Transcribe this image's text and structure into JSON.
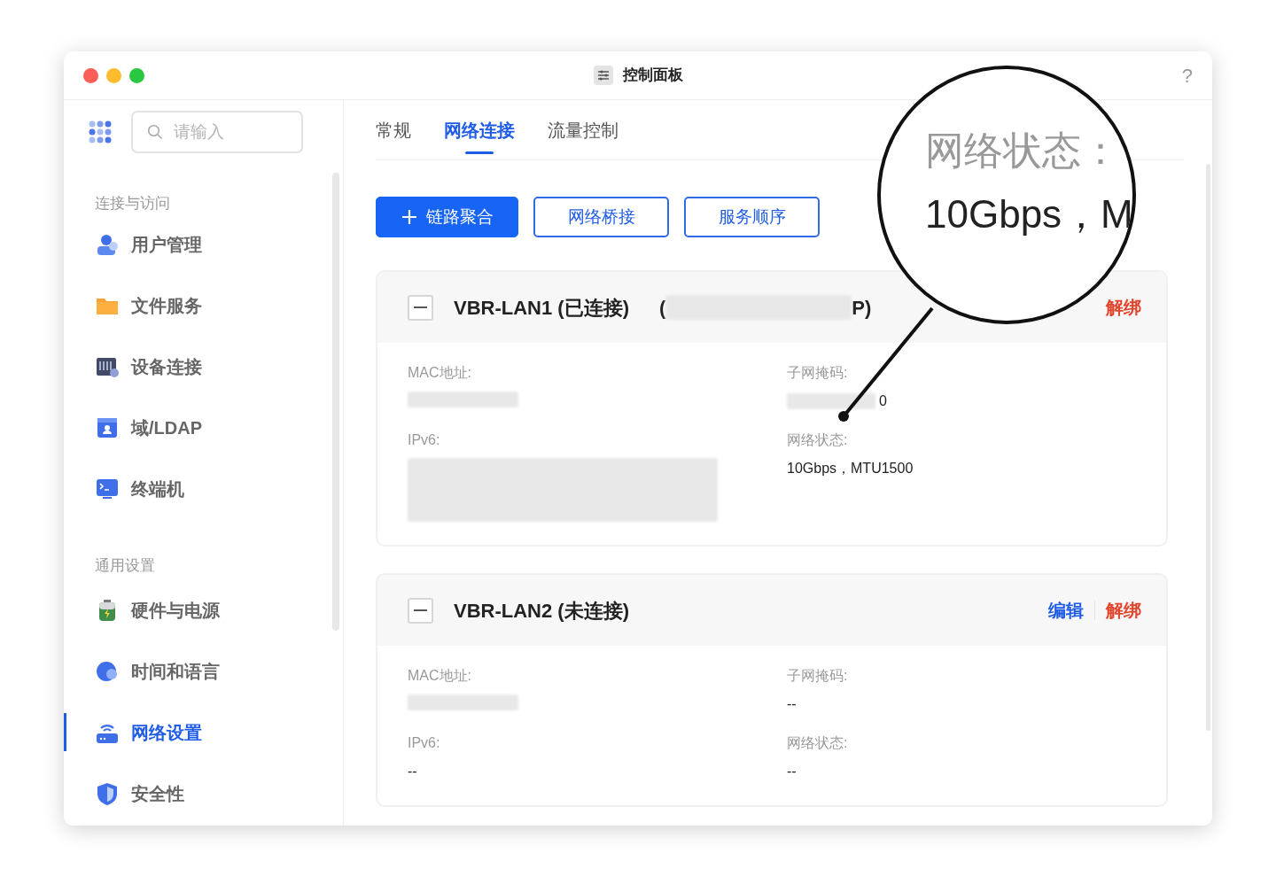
{
  "window": {
    "title": "控制面板",
    "help": "?"
  },
  "sidebar": {
    "search": {
      "placeholder": "请输入"
    },
    "sections": [
      {
        "heading": "连接与访问",
        "items": [
          {
            "label": "用户管理",
            "selected": false
          },
          {
            "label": "文件服务",
            "selected": false
          },
          {
            "label": "设备连接",
            "selected": false
          },
          {
            "label": "域/LDAP",
            "selected": false
          },
          {
            "label": "终端机",
            "selected": false
          }
        ]
      },
      {
        "heading": "通用设置",
        "items": [
          {
            "label": "硬件与电源",
            "selected": false
          },
          {
            "label": "时间和语言",
            "selected": false
          },
          {
            "label": "网络设置",
            "selected": true
          },
          {
            "label": "安全性",
            "selected": false
          }
        ]
      }
    ]
  },
  "tabs": [
    {
      "label": "常规",
      "selected": false
    },
    {
      "label": "网络连接",
      "selected": true
    },
    {
      "label": "流量控制",
      "selected": false
    }
  ],
  "actions": [
    {
      "label": "链路聚合",
      "kind": "primary"
    },
    {
      "label": "网络桥接",
      "kind": "outline"
    },
    {
      "label": "服务顺序",
      "kind": "outline"
    }
  ],
  "interfaces": [
    {
      "name": "VBR-LAN1 (已连接)",
      "ip_open": "(",
      "ip_close": "P)",
      "links": [
        {
          "label": "解绑",
          "kind": "danger"
        }
      ],
      "fields": [
        {
          "label": "MAC地址:",
          "redacted": true
        },
        {
          "label": "子网掩码:",
          "redacted": true,
          "value": "0"
        },
        {
          "label": "IPv6:",
          "redacted": true
        },
        {
          "label": "网络状态:",
          "redacted": false,
          "value": "10Gbps，MTU1500"
        }
      ]
    },
    {
      "name": "VBR-LAN2 (未连接)",
      "links": [
        {
          "label": "编辑",
          "kind": "primary"
        },
        {
          "label": "解绑",
          "kind": "danger"
        }
      ],
      "fields": [
        {
          "label": "MAC地址:",
          "redacted": true
        },
        {
          "label": "子网掩码:",
          "redacted": false,
          "value": "--"
        },
        {
          "label": "IPv6:",
          "redacted": false,
          "value": "--"
        },
        {
          "label": "网络状态:",
          "redacted": false,
          "value": "--"
        }
      ]
    }
  ],
  "magnifier": {
    "label": "网络状态：",
    "value": "10Gbps，M"
  }
}
